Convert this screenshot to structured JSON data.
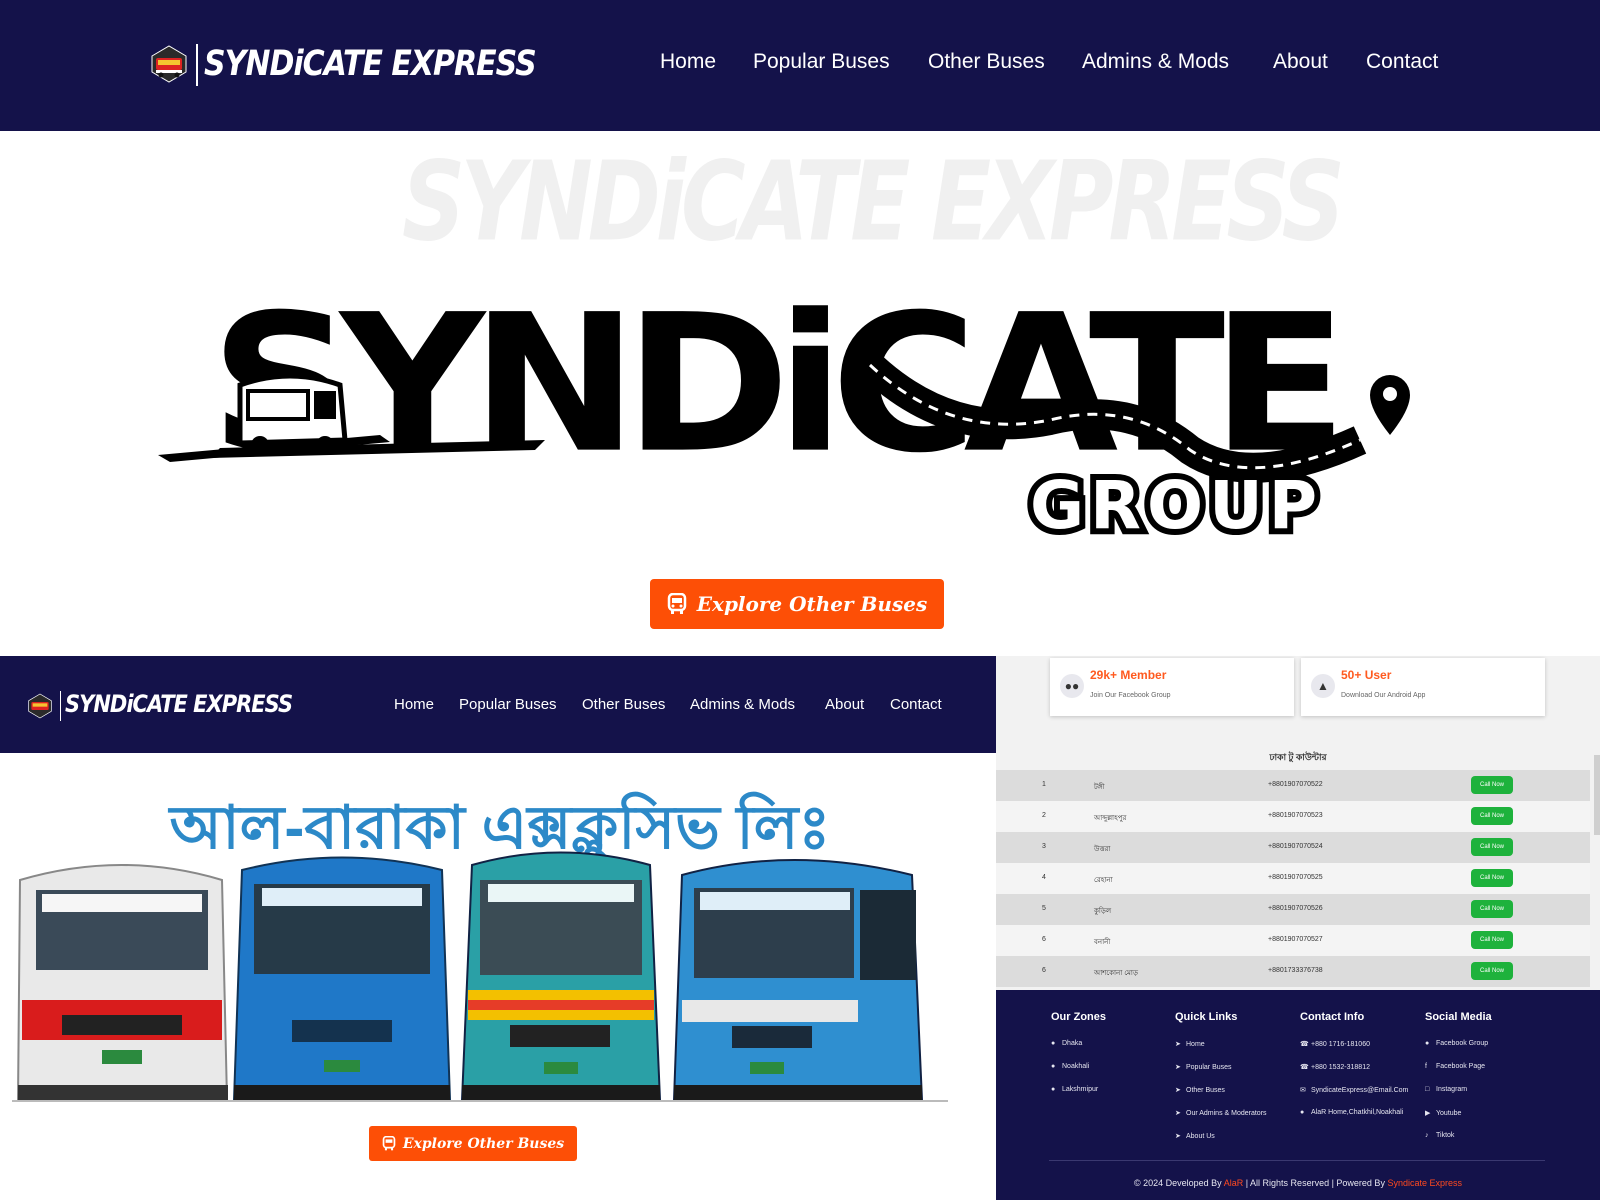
{
  "top": {
    "brand": "SYNDiCATE EXPRESS",
    "nav": [
      "Home",
      "Popular Buses",
      "Other Buses",
      "Admins & Mods",
      "About",
      "Contact"
    ],
    "watermark": "SYNDiCATE EXPRESS",
    "logo_text": "SYNDiCATE",
    "logo_sub": "GROUP",
    "cta": "Explore Other Buses"
  },
  "bottom_left": {
    "brand": "SYNDiCATE EXPRESS",
    "nav": [
      "Home",
      "Popular Buses",
      "Other Buses",
      "Admins & Mods",
      "About",
      "Contact"
    ],
    "title": "আল-বারাকা এক্সক্লুসিভ লিঃ",
    "cta": "Explore Other Buses"
  },
  "bottom_right": {
    "stats": [
      {
        "title": "29k+ Member",
        "subtitle": "Join Our Facebook Group",
        "icon": "group-icon"
      },
      {
        "title": "50+ User",
        "subtitle": "Download Our Android App",
        "icon": "android-icon"
      }
    ],
    "table_title": "ঢাকা টু কাউন্টার",
    "rows": [
      {
        "no": "1",
        "name": "টঙ্গী",
        "phone": "+8801907070522",
        "action": "Call Now"
      },
      {
        "no": "2",
        "name": "আব্দুল্লাহপুর",
        "phone": "+8801907070523",
        "action": "Call Now"
      },
      {
        "no": "3",
        "name": "উত্তরা",
        "phone": "+8801907070524",
        "action": "Call Now"
      },
      {
        "no": "4",
        "name": "রেহানা",
        "phone": "+8801907070525",
        "action": "Call Now"
      },
      {
        "no": "5",
        "name": "কুড়িল",
        "phone": "+8801907070526",
        "action": "Call Now"
      },
      {
        "no": "6",
        "name": "বনানী",
        "phone": "+8801907070527",
        "action": "Call Now"
      },
      {
        "no": "6",
        "name": "আশকোনা মোড়",
        "phone": "+8801733376738",
        "action": "Call Now"
      }
    ],
    "footer": {
      "zones_title": "Our Zones",
      "zones": [
        "Dhaka",
        "Noakhali",
        "Lakshmipur"
      ],
      "links_title": "Quick Links",
      "links": [
        "Home",
        "Popular Buses",
        "Other Buses",
        "Our Admins & Moderators",
        "About Us"
      ],
      "contact_title": "Contact Info",
      "contact": [
        "+880 1716-181060",
        "+880 1532-318812",
        "SyndicateExpress@Email.Com",
        "AlaR Home,Chatkhil,Noakhali"
      ],
      "social_title": "Social Media",
      "social": [
        "Facebook Group",
        "Facebook Page",
        "Instagram",
        "Youtube",
        "Tiktok"
      ],
      "copyright_pre": "© 2024 Developed By ",
      "developer": "AlaR",
      "copyright_mid": " | All Rights Reserved | Powered By ",
      "powered": "Syndicate Express"
    }
  }
}
